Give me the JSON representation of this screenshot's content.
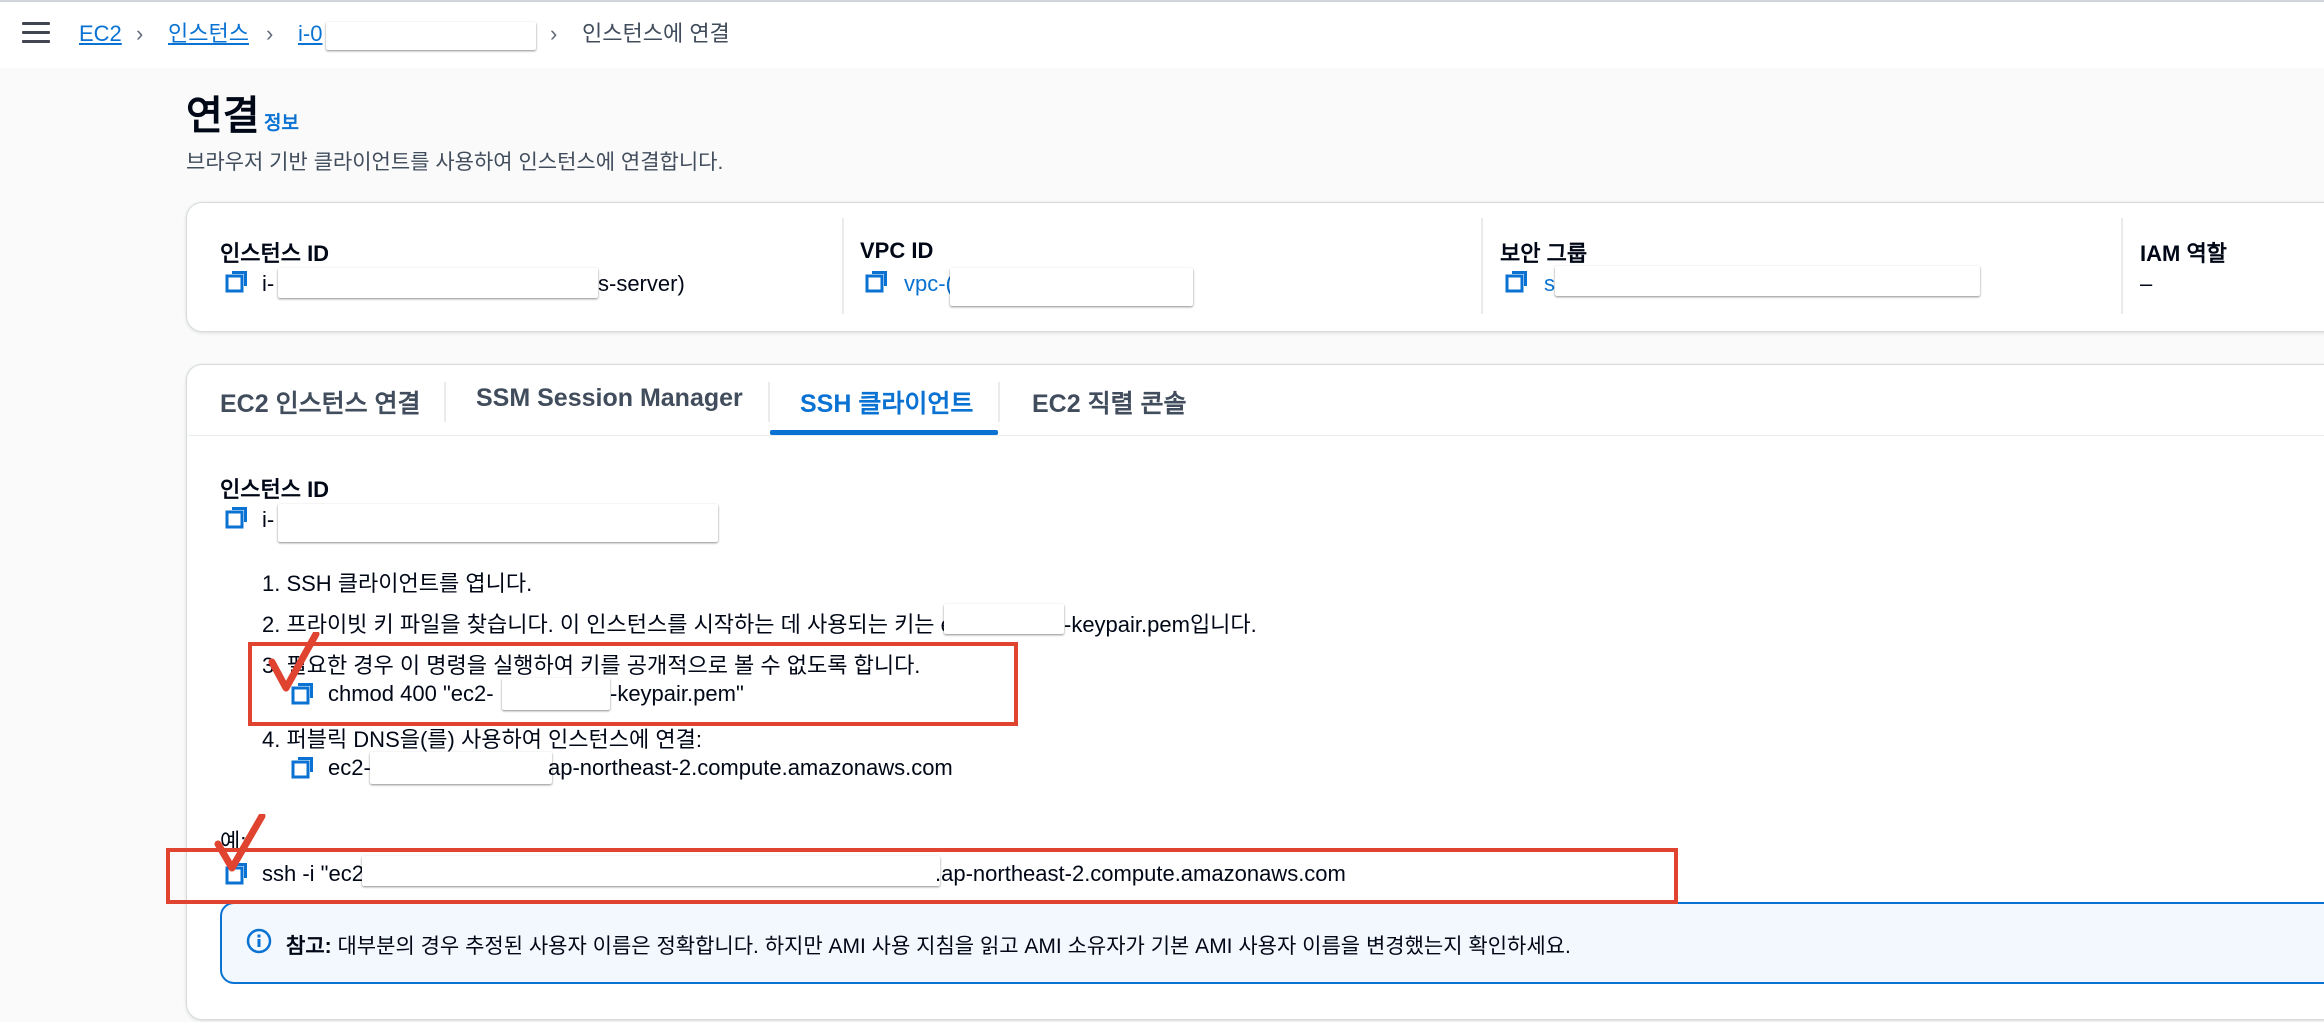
{
  "breadcrumb": {
    "items": [
      "EC2",
      "인스턴스",
      "i-0"
    ],
    "current": "인스턴스에 연결"
  },
  "header": {
    "title": "연결",
    "info_link": "정보",
    "description": "브라우저 기반 클라이언트를 사용하여 인스턴스에 연결합니다."
  },
  "summary": {
    "instance_id_label": "인스턴스 ID",
    "instance_id_prefix": "i-",
    "instance_id_suffix": "s-server)",
    "vpc_label": "VPC ID",
    "vpc_prefix": "vpc-(",
    "sg_label": "보안 그룹",
    "sg_prefix": "s",
    "iam_label": "IAM 역할",
    "iam_value": "–"
  },
  "tabs": [
    {
      "label": "EC2 인스턴스 연결",
      "active": false
    },
    {
      "label": "SSM Session Manager",
      "active": false
    },
    {
      "label": "SSH 클라이언트",
      "active": true
    },
    {
      "label": "EC2 직렬 콘솔",
      "active": false
    }
  ],
  "ssh": {
    "instance_id_label": "인스턴스 ID",
    "instance_id_prefix": "i-",
    "step1": "1. SSH 클라이언트를 엽니다.",
    "step2_a": "2. 프라이빗 키 파일을 찾습니다. 이 인스턴스를 시작하는 데 사용되는 키는 ec2",
    "step2_b": "-keypair.pem입니다.",
    "step3": "3. 필요한 경우 이 명령을 실행하여 키를 공개적으로 볼 수 없도록 합니다.",
    "chmod_a": "chmod 400 \"ec2-",
    "chmod_b": "-keypair.pem\"",
    "step4": "4. 퍼블릭 DNS을(를) 사용하여 인스턴스에 연결:",
    "dns_a": "ec2-",
    "dns_b": "ap-northeast-2.compute.amazonaws.com",
    "example_label": "예:",
    "ssh_a": "ssh -i \"ec2",
    "ssh_b": ".ap-northeast-2.compute.amazonaws.com"
  },
  "note": {
    "label": "참고:",
    "text": "대부분의 경우 추정된 사용자 이름은 정확합니다. 하지만 AMI 사용 지침을 읽고 AMI 소유자가 기본 AMI 사용자 이름을 변경했는지 확인하세요."
  },
  "colors": {
    "accent": "#0972d3",
    "annotation_red": "#e0432f"
  },
  "icons": [
    "menu-icon",
    "chevron-right-icon",
    "copy-icon",
    "info-icon",
    "checkmark-icon"
  ]
}
